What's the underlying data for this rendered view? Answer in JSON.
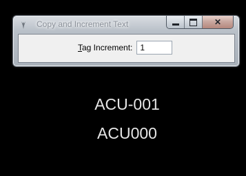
{
  "window": {
    "title": "Copy and Increment Text",
    "icon": "microstation-icon",
    "controls": {
      "minimize": "minimize-icon",
      "maximize": "maximize-icon",
      "close": "close-icon"
    }
  },
  "form": {
    "tag_increment_label_prefix": "T",
    "tag_increment_label_rest": "ag Increment:",
    "tag_increment_value": "1"
  },
  "canvas": {
    "text_1": "ACU-001",
    "text_2": "ACU000"
  }
}
